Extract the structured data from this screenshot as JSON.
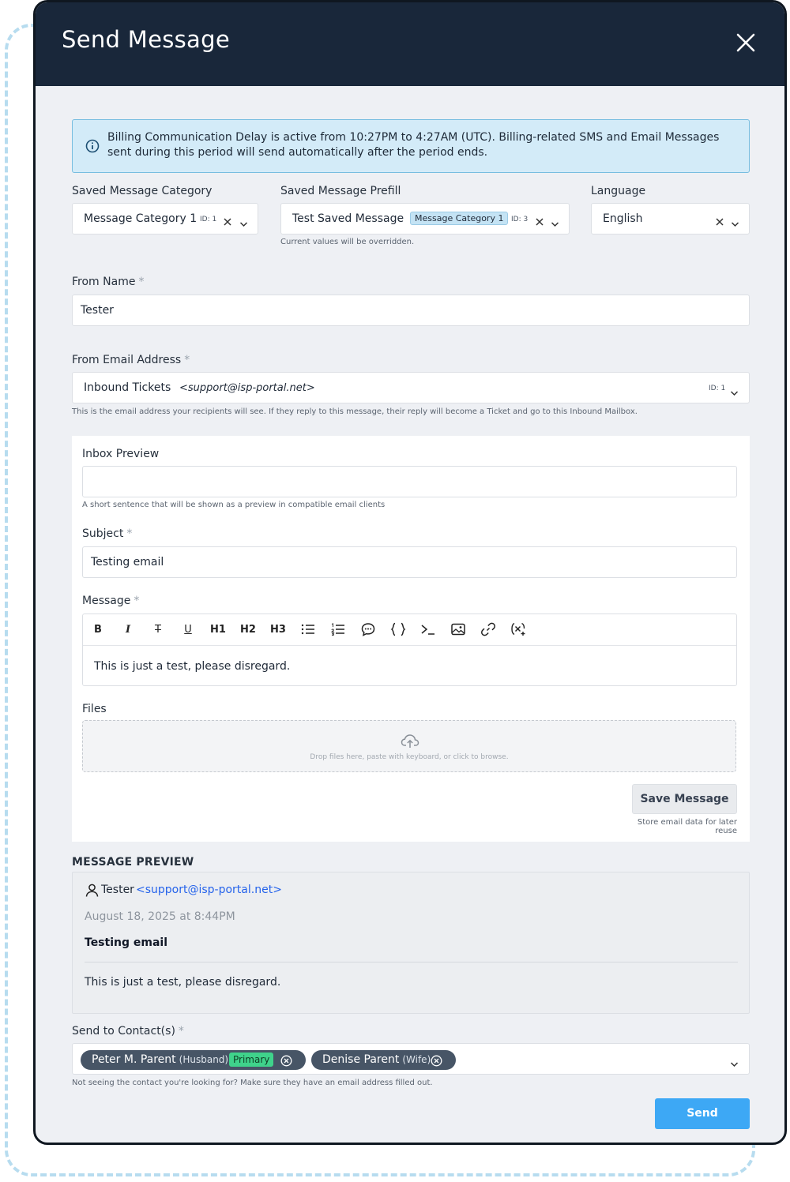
{
  "modal": {
    "title": "Send Message"
  },
  "alert": {
    "text": "Billing Communication Delay is active from 10:27PM to 4:27AM (UTC). Billing-related SMS and Email Messages sent during this period will send automatically after the period ends."
  },
  "saved_category": {
    "label": "Saved Message Category",
    "value": "Message Category 1",
    "id": "ID: 1"
  },
  "saved_prefill": {
    "label": "Saved Message Prefill",
    "value": "Test Saved Message",
    "chip": "Message Category 1",
    "id": "ID: 3",
    "help": "Current values will be overridden."
  },
  "language": {
    "label": "Language",
    "value": "English"
  },
  "from_name": {
    "label": "From Name",
    "required": "*",
    "value": "Tester"
  },
  "from_email": {
    "label": "From Email Address",
    "required": "*",
    "name": "Inbound Tickets",
    "address": "<support@isp-portal.net>",
    "id": "ID: 1",
    "help": "This is the email address your recipients will see. If they reply to this message, their reply will become a Ticket and go to this Inbound Mailbox."
  },
  "inbox_preview": {
    "label": "Inbox Preview",
    "value": "",
    "help": "A short sentence that will be shown as a preview in compatible email clients"
  },
  "subject": {
    "label": "Subject",
    "required": "*",
    "value": "Testing email"
  },
  "message": {
    "label": "Message",
    "required": "*",
    "toolbar": [
      "B",
      "I",
      "T",
      "U",
      "H1",
      "H2",
      "H3",
      "bullet-list-icon",
      "ordered-list-icon",
      "comment-icon",
      "code-block-icon",
      "terminal-icon",
      "image-icon",
      "link-icon",
      "variable-icon"
    ],
    "body": "This is just a test, please disregard."
  },
  "files": {
    "label": "Files",
    "drop_text": "Drop files here, paste with keyboard, or click to browse."
  },
  "save_message": {
    "button": "Save Message",
    "help": "Store email data for later reuse"
  },
  "preview": {
    "title": "MESSAGE PREVIEW",
    "from_name": "Tester",
    "from_email": "<support@isp-portal.net>",
    "date": "August 18, 2025 at 8:44PM",
    "subject": "Testing email",
    "body": "This is just a test, please disregard."
  },
  "send_to": {
    "label": "Send to Contact(s)",
    "required": "*",
    "contacts": [
      {
        "name": "Peter M. Parent",
        "relation": "(Husband)",
        "badge": "Primary"
      },
      {
        "name": "Denise Parent",
        "relation": "(Wife)"
      }
    ],
    "help": "Not seeing the contact you're looking for? Make sure they have an email address filled out."
  },
  "send_button": "Send",
  "colors": {
    "header": "#19273a",
    "alert_bg": "#d3ebf8",
    "send": "#3da8f5",
    "chip": "#475566",
    "primary_badge": "#3fd38b",
    "link": "#2563eb"
  }
}
